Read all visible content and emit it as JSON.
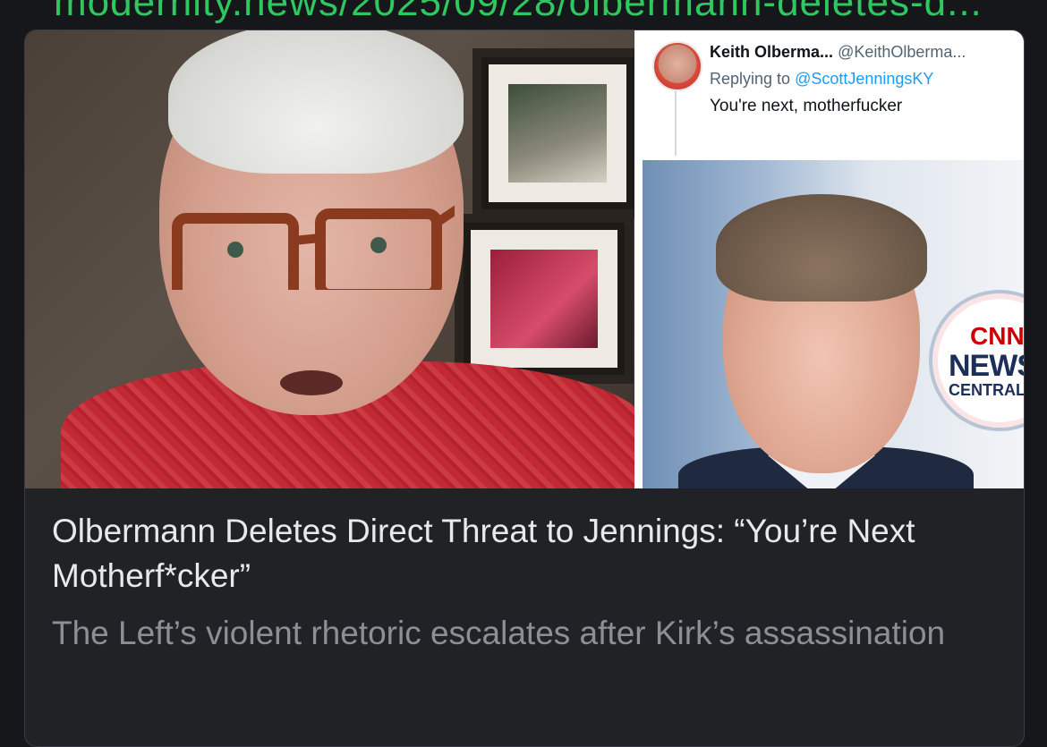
{
  "url_text": "modernity.news/2025/09/28/olbermann-deletes-d...",
  "tweet": {
    "name": "Keith Olberma...",
    "handle": "@KeithOlberma...",
    "reply_prefix": "Replying to",
    "reply_mention": "@ScottJenningsKY",
    "text": "You're next, motherfucker"
  },
  "badge": {
    "logo": "CNN",
    "line1": "NEWS",
    "line2": "CENTRAL"
  },
  "card": {
    "headline": "Olbermann Deletes Direct Threat to Jennings: “You’re Next Motherf*cker”",
    "subhead": "The Left’s violent rhetoric escalates after Kirk’s assassination"
  },
  "colors": {
    "background": "#15171b",
    "card_bg": "#202226",
    "link_green": "#2fc760",
    "headline": "#e7e9ea",
    "subhead": "#8b9096",
    "mention_blue": "#1d9bf0"
  }
}
